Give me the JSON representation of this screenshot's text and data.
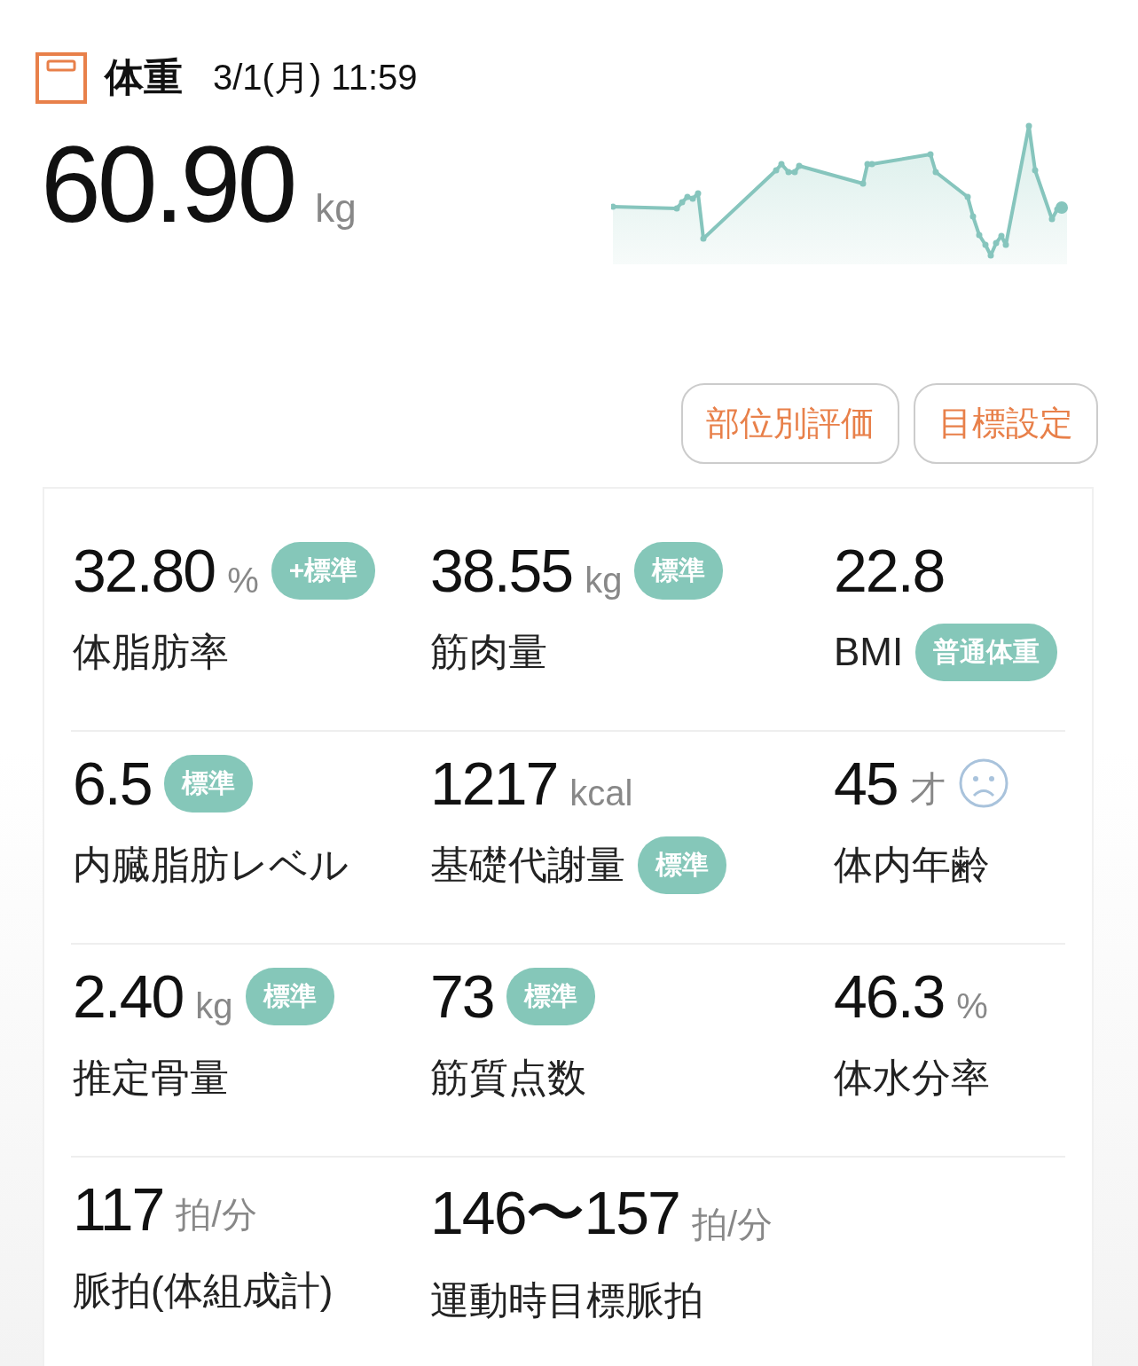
{
  "header": {
    "title": "体重",
    "datetime": "3/1(月) 11:59"
  },
  "weight": {
    "value": "60.90",
    "unit": "kg"
  },
  "buttons": [
    "部位別評価",
    "目標設定"
  ],
  "metrics": [
    {
      "kind": "value_badge",
      "value": "32.80",
      "unit": "%",
      "label": "体脂肪率",
      "badge": "+標準"
    },
    {
      "kind": "value_badge",
      "value": "38.55",
      "unit": "kg",
      "label": "筋肉量",
      "badge": "標準"
    },
    {
      "kind": "label_badge",
      "value": "22.8",
      "label": "BMI",
      "badge": "普通体重"
    },
    {
      "kind": "value_badge",
      "value": "6.5",
      "label": "内臓脂肪レベル",
      "badge": "標準"
    },
    {
      "kind": "label_badge",
      "value": "1217",
      "unit": "kcal",
      "label": "基礎代謝量",
      "badge": "標準"
    },
    {
      "kind": "sad_face",
      "value": "45",
      "unit": "才",
      "label": "体内年齢"
    },
    {
      "kind": "value_badge",
      "value": "2.40",
      "unit": "kg",
      "label": "推定骨量",
      "badge": "標準"
    },
    {
      "kind": "value_badge",
      "value": "73",
      "label": "筋質点数",
      "badge": "標準"
    },
    {
      "kind": "plain",
      "value": "46.3",
      "unit": "%",
      "label": "体水分率"
    },
    {
      "kind": "plain",
      "value": "117",
      "unit": "拍/分",
      "label": "脈拍(体組成計)"
    },
    {
      "kind": "plain",
      "value": "146〜157",
      "unit": "拍/分",
      "label": "運動時目標脈拍"
    }
  ]
}
